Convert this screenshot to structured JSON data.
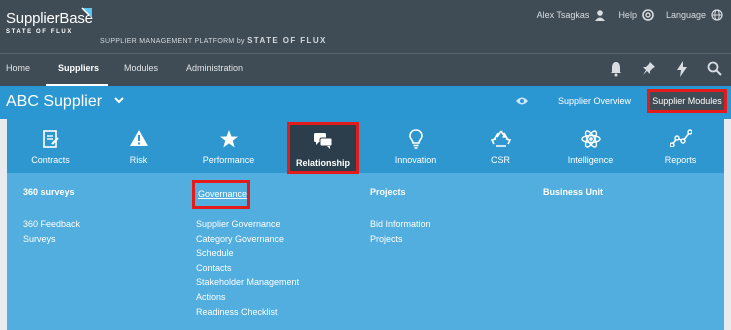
{
  "brand": {
    "name": "SupplierBase",
    "sub": "STATE OF FLUX",
    "platform": "SUPPLIER MANAGEMENT PLATFORM",
    "platform_by": "by",
    "platform_org": "STATE OF FLUX"
  },
  "user": {
    "name": "Alex Tsagkas",
    "help": "Help",
    "language": "Language"
  },
  "nav": {
    "items": [
      {
        "label": "Home"
      },
      {
        "label": "Suppliers"
      },
      {
        "label": "Modules"
      },
      {
        "label": "Administration"
      }
    ],
    "active": "Suppliers"
  },
  "supplier": {
    "name": "ABC Supplier",
    "overview_link": "Supplier Overview",
    "modules_button": "Supplier Modules"
  },
  "modules": [
    {
      "label": "Contracts",
      "icon": "contracts-icon"
    },
    {
      "label": "Risk",
      "icon": "risk-icon"
    },
    {
      "label": "Performance",
      "icon": "star-icon"
    },
    {
      "label": "Relationship",
      "icon": "chat-icon"
    },
    {
      "label": "Innovation",
      "icon": "lightbulb-icon"
    },
    {
      "label": "CSR",
      "icon": "recycle-icon"
    },
    {
      "label": "Intelligence",
      "icon": "atom-icon"
    },
    {
      "label": "Reports",
      "icon": "graph-icon"
    }
  ],
  "active_module": "Relationship",
  "columns": [
    {
      "heading": "360 surveys",
      "items": [
        "360 Feedback",
        "Surveys"
      ]
    },
    {
      "heading": "Governance",
      "items": [
        "Supplier Governance",
        "Category Governance",
        "Schedule",
        "Contacts",
        "Stakeholder Management",
        "Actions",
        "Readiness Checklist"
      ]
    },
    {
      "heading": "Projects",
      "items": [
        "Bid Information",
        "Projects"
      ]
    },
    {
      "heading": "Business Unit",
      "items": []
    }
  ],
  "colors": {
    "header_bg": "#3f4b55",
    "bar_bg": "#2b97d2",
    "panel_bg": "#52aede",
    "tile_bg": "#2e97d0",
    "highlight": "#e31b1b"
  }
}
